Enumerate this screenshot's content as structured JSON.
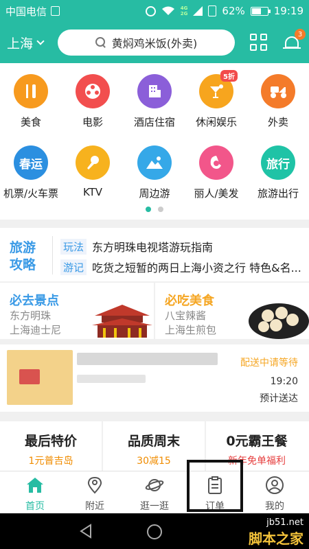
{
  "status_bar": {
    "carrier": "中国电信",
    "net_top": "4G",
    "net_bottom": "2G",
    "battery_percent": "62%",
    "battery_level": 0.62,
    "time": "19:19"
  },
  "header": {
    "city": "上海",
    "search_placeholder": "黄焖鸡米饭(外卖)",
    "notification_count": "3"
  },
  "categories": [
    {
      "label": "美食",
      "color": "#f79a1e",
      "icon": "cutlery-icon"
    },
    {
      "label": "电影",
      "color": "#f24e4e",
      "icon": "film-reel-icon"
    },
    {
      "label": "酒店住宿",
      "color": "#8b5fd9",
      "icon": "hotel-icon"
    },
    {
      "label": "休闲娱乐",
      "color": "#f7a51e",
      "icon": "cocktail-icon",
      "badge": "5折"
    },
    {
      "label": "外卖",
      "color": "#f47b2a",
      "icon": "delivery-scooter-icon"
    },
    {
      "label": "机票/火车票",
      "color": "#2b8fe0",
      "icon": "train-icon",
      "text": "春运"
    },
    {
      "label": "KTV",
      "color": "#f7b21e",
      "icon": "microphone-icon"
    },
    {
      "label": "周边游",
      "color": "#35a8e8",
      "icon": "landscape-icon"
    },
    {
      "label": "丽人/美发",
      "color": "#f2568a",
      "icon": "woman-icon"
    },
    {
      "label": "旅游出行",
      "color": "#1fc3a6",
      "icon": "travel-icon",
      "text": "旅行"
    }
  ],
  "pager": {
    "current": 1,
    "total": 2
  },
  "strategy": {
    "title_line1": "旅游",
    "title_line2": "攻略",
    "items": [
      {
        "tag": "玩法",
        "text": "东方明珠电视塔游玩指南"
      },
      {
        "tag": "游记",
        "text": "吃货之短暂的两日上海小资之行 特色&名..."
      }
    ]
  },
  "must_go": {
    "title": "必去景点",
    "title_color": "#3a9ae6",
    "items": [
      "东方明珠",
      "上海迪士尼"
    ]
  },
  "must_eat": {
    "title": "必吃美食",
    "title_color": "#f5a623",
    "items": [
      "八宝辣酱",
      "上海生煎包"
    ]
  },
  "order": {
    "status": "配送中请等待",
    "time": "19:20",
    "eta_label": "预计送达"
  },
  "deals": [
    {
      "title": "最后特价",
      "sub": "1元普吉岛"
    },
    {
      "title": "品质周末",
      "sub": "30减15"
    },
    {
      "title": "0元霸王餐",
      "sub": "新年免单福利"
    }
  ],
  "tabs": [
    {
      "label": "首页",
      "icon": "home-icon",
      "active": true
    },
    {
      "label": "附近",
      "icon": "location-pin-icon"
    },
    {
      "label": "逛一逛",
      "icon": "planet-icon"
    },
    {
      "label": "订单",
      "icon": "clipboard-icon"
    },
    {
      "label": "我的",
      "icon": "user-icon"
    }
  ],
  "watermark": {
    "line1": "jb51.net",
    "line2": "脚本之家"
  },
  "colors": {
    "brand": "#27bca3",
    "accent_orange": "#f5a623",
    "link_blue": "#3a9ae6"
  }
}
